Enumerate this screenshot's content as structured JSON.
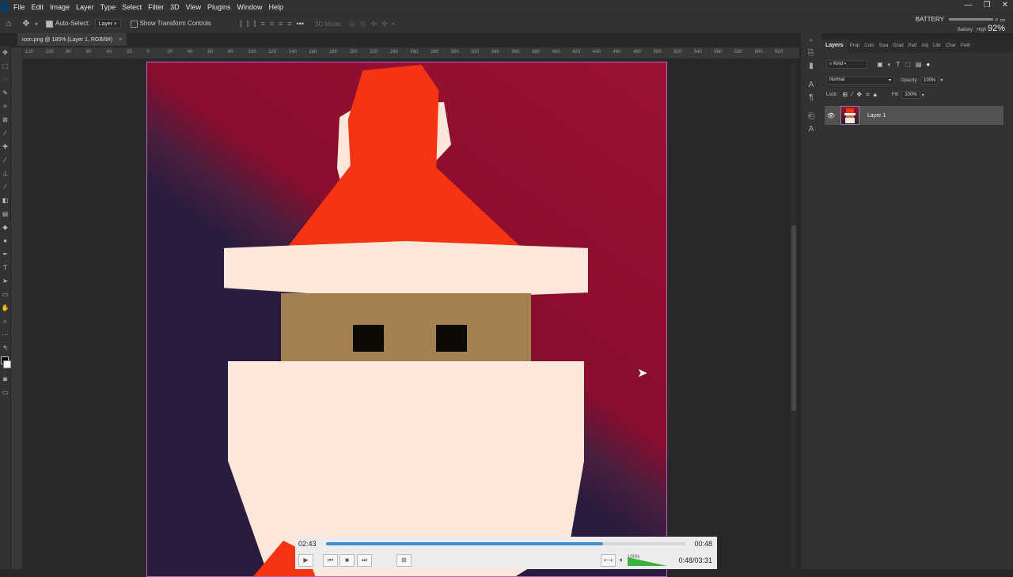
{
  "menubar": {
    "items": [
      "File",
      "Edit",
      "Image",
      "Layer",
      "Type",
      "Select",
      "Filter",
      "3D",
      "View",
      "Plugins",
      "Window",
      "Help"
    ]
  },
  "window_controls": {
    "minimize": "—",
    "restore": "❐",
    "close": "✕"
  },
  "options_bar": {
    "auto_select_label": "Auto-Select:",
    "auto_select_target": "Layer",
    "show_transform_label": "Show Transform Controls",
    "mode_3d_label": "3D Mode:"
  },
  "document_tab": {
    "title": "icon.png @ 185% (Layer 1, RGB/8#)",
    "close": "×"
  },
  "ruler_top_ticks": [
    "120",
    "100",
    "80",
    "60",
    "40",
    "20",
    "0",
    "20",
    "40",
    "60",
    "80",
    "100",
    "120",
    "140",
    "160",
    "180",
    "200",
    "220",
    "240",
    "260",
    "280",
    "300",
    "320",
    "340",
    "360",
    "380",
    "400",
    "420",
    "440",
    "460",
    "480",
    "500",
    "520",
    "540",
    "560",
    "580",
    "600",
    "620"
  ],
  "layers_panel": {
    "tabs": [
      "Layers",
      "Prop",
      "Colo",
      "Swa",
      "Grad",
      "Patt",
      "Adj",
      "Libr",
      "Char",
      "Path"
    ],
    "filter_kind": "Kind",
    "blend_mode": "Normal",
    "opacity_label": "Opacity:",
    "opacity_value": "100%",
    "lock_label": "Lock:",
    "fill_label": "Fill:",
    "fill_value": "100%",
    "layers": [
      {
        "name": "Layer 1",
        "visible": true
      }
    ]
  },
  "battery_overlay": {
    "label": "BATTERY",
    "sub_label": "Battery",
    "high_label": "High",
    "percent": "92%"
  },
  "media_player": {
    "time_left": "02:43",
    "time_right": "00:48",
    "progress": 0.77,
    "volume_label": "100%",
    "total_time": "0:48/03:31"
  },
  "colors": {
    "accent_blue": "#3d8ed6",
    "canvas_border": "#c060c0",
    "hat_red": "#f53414",
    "trim_cream": "#fde7db",
    "face_tan": "#a47f4f",
    "eyes": "#0d0a08"
  }
}
